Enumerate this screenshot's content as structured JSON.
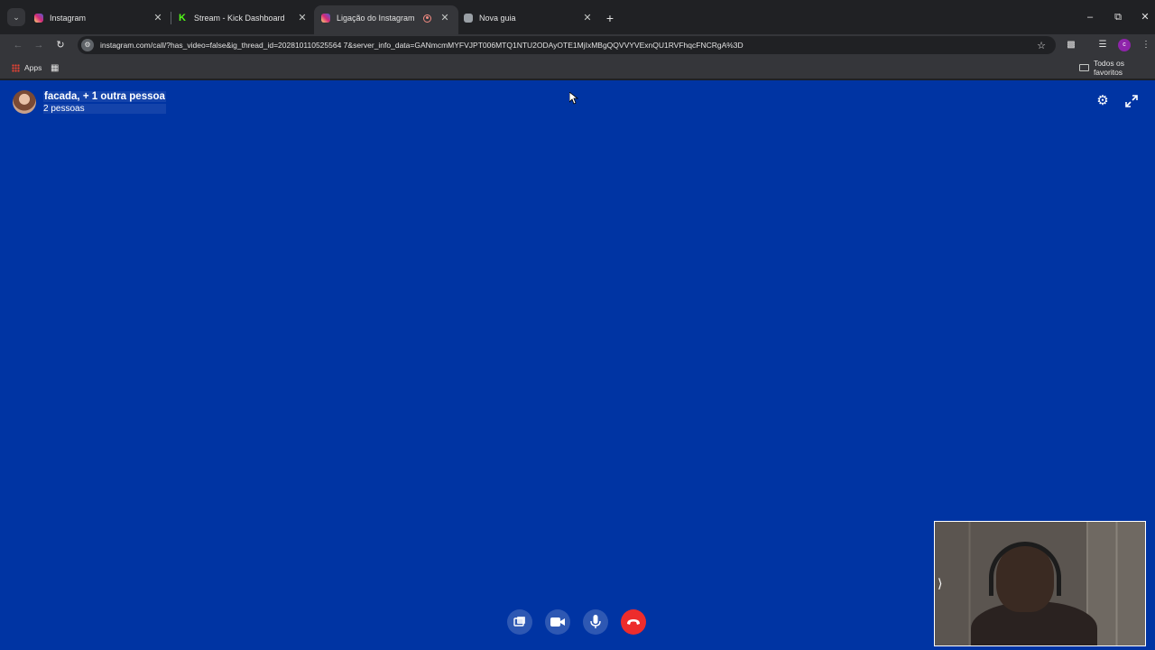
{
  "browser": {
    "tabs": [
      {
        "title": "Instagram",
        "favicon": "instagram-icon",
        "active": false
      },
      {
        "title": "Stream - Kick Dashboard",
        "favicon": "kick-icon",
        "active": false
      },
      {
        "title": "Ligação do Instagram",
        "favicon": "instagram-icon",
        "active": true,
        "recording": true
      },
      {
        "title": "Nova guia",
        "favicon": "chrome-icon",
        "active": false
      }
    ],
    "url": "instagram.com/call/?has_video=false&ig_thread_id=202810110525564 7&server_info_data=GANmcmMYFVJPT006MTQ1NTU2ODAyOTE1MjIxMBgQQVVYVExnQU1RVFhqcFNCRgA%3D",
    "profile_initial": "c",
    "bookmarks": {
      "apps_label": "Apps",
      "all_bookmarks_label": "Todos os favoritos"
    }
  },
  "call": {
    "title": "facada, + 1 outra pessoa",
    "participants": "2 pessoas",
    "background_color": "#0034a3",
    "end_call_color": "#ed2c2c",
    "controls": [
      "screen-share-icon",
      "video-camera-icon",
      "microphone-icon",
      "end-call-icon"
    ]
  }
}
